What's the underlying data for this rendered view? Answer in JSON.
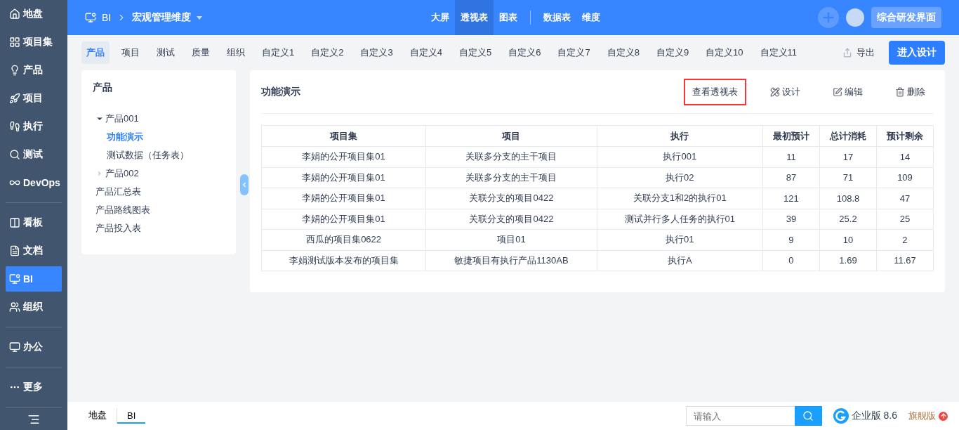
{
  "sidebar": {
    "groups": [
      [
        {
          "label": "地盘",
          "selected": false
        },
        {
          "label": "项目集",
          "selected": false
        },
        {
          "label": "产品",
          "selected": false
        },
        {
          "label": "项目",
          "selected": false
        },
        {
          "label": "执行",
          "selected": false
        },
        {
          "label": "测试",
          "selected": false
        },
        {
          "label": "DevOps",
          "selected": false
        }
      ],
      [
        {
          "label": "看板",
          "selected": false
        },
        {
          "label": "文档",
          "selected": false
        },
        {
          "label": "BI",
          "selected": true
        },
        {
          "label": "组织",
          "selected": false
        }
      ],
      [
        {
          "label": "办公",
          "selected": false
        }
      ],
      [
        {
          "label": "更多",
          "selected": false
        }
      ]
    ]
  },
  "header": {
    "app": "BI",
    "breadcrumb": "宏观管理维度",
    "nav": [
      {
        "label": "大屏",
        "selected": false
      },
      {
        "label": "透视表",
        "selected": true
      },
      {
        "label": "图表",
        "selected": false
      }
    ],
    "nav_right": [
      {
        "label": "数据表",
        "selected": false
      },
      {
        "label": "维度",
        "selected": false
      }
    ],
    "workspace_button": "综合研发界面"
  },
  "tabs": [
    {
      "label": "产品",
      "selected": true
    },
    {
      "label": "项目",
      "selected": false
    },
    {
      "label": "测试",
      "selected": false
    },
    {
      "label": "质量",
      "selected": false
    },
    {
      "label": "组织",
      "selected": false
    },
    {
      "label": "自定义1",
      "selected": false
    },
    {
      "label": "自定义2",
      "selected": false
    },
    {
      "label": "自定义3",
      "selected": false
    },
    {
      "label": "自定义4",
      "selected": false
    },
    {
      "label": "自定义5",
      "selected": false
    },
    {
      "label": "自定义6",
      "selected": false
    },
    {
      "label": "自定义7",
      "selected": false
    },
    {
      "label": "自定义8",
      "selected": false
    },
    {
      "label": "自定义9",
      "selected": false
    },
    {
      "label": "自定义10",
      "selected": false
    },
    {
      "label": "自定义11",
      "selected": false
    }
  ],
  "export_label": "导出",
  "design_button": "进入设计",
  "tree": {
    "title": "产品",
    "items": [
      {
        "label": "产品001",
        "selected": false,
        "expanded": true,
        "children": [
          {
            "label": "功能演示",
            "selected": true
          },
          {
            "label": "测试数据（任务表）",
            "selected": false
          }
        ]
      },
      {
        "label": "产品002",
        "selected": false,
        "expanded": false
      },
      {
        "label": "产品汇总表",
        "selected": false
      },
      {
        "label": "产品路线图表",
        "selected": false
      },
      {
        "label": "产品投入表",
        "selected": false
      }
    ]
  },
  "panel": {
    "title": "功能演示",
    "actions": [
      {
        "label": "查看透视表",
        "highlighted": true
      },
      {
        "label": "设计",
        "highlighted": false
      },
      {
        "label": "编辑",
        "highlighted": false
      },
      {
        "label": "删除",
        "highlighted": false
      }
    ],
    "table": {
      "columns": [
        "项目集",
        "项目",
        "执行",
        "最初预计",
        "总计消耗",
        "预计剩余"
      ],
      "rows": [
        [
          "李娟的公开项目集01",
          "关联多分支的主干项目",
          "执行001",
          "11",
          "17",
          "14"
        ],
        [
          "李娟的公开项目集01",
          "关联多分支的主干项目",
          "执行02",
          "87",
          "71",
          "109"
        ],
        [
          "李娟的公开项目集01",
          "关联分支的项目0422",
          "关联分支1和2的执行01",
          "121",
          "108.8",
          "47"
        ],
        [
          "李娟的公开项目集01",
          "关联分支的项目0422",
          "测试并行多人任务的执行01",
          "39",
          "25.2",
          "25"
        ],
        [
          "西瓜的项目集0622",
          "项目01",
          "执行01",
          "9",
          "10",
          "2"
        ],
        [
          "李娟测试版本发布的项目集",
          "敏捷项目有执行产品1130AB",
          "执行A",
          "0",
          "1.69",
          "11.67"
        ]
      ]
    }
  },
  "footer": {
    "tabs": [
      {
        "label": "地盘",
        "selected": false
      },
      {
        "label": "BI",
        "selected": true
      }
    ],
    "search": {
      "placeholder": "请输入"
    },
    "edition": "企业版 8.6",
    "upgrade": "旗舰版"
  }
}
